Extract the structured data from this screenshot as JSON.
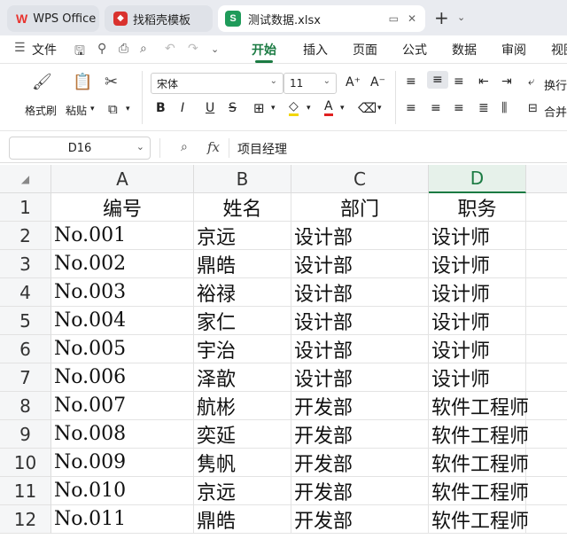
{
  "tabs": {
    "wps_label": "WPS Office",
    "template_label": "找稻壳模板",
    "doc_label": "测试数据.xlsx"
  },
  "menu": {
    "file": "文件",
    "items": [
      "开始",
      "插入",
      "页面",
      "公式",
      "数据",
      "审阅",
      "视图"
    ]
  },
  "ribbon": {
    "format_painter": "格式刷",
    "paste": "粘贴",
    "font_name": "宋体",
    "font_size": "11",
    "wrap": "换行",
    "merge": "合并"
  },
  "formula_bar": {
    "cell_ref": "D16",
    "fx": "fx",
    "content": "项目经理"
  },
  "sheet": {
    "columns": [
      "A",
      "B",
      "C",
      "D"
    ],
    "rows": [
      {
        "num": "1",
        "cells": [
          "编号",
          "姓名",
          "部门",
          "职务"
        ]
      },
      {
        "num": "2",
        "cells": [
          "No.001",
          "京远",
          "设计部",
          "设计师"
        ]
      },
      {
        "num": "3",
        "cells": [
          "No.002",
          "鼎皓",
          "设计部",
          "设计师"
        ]
      },
      {
        "num": "4",
        "cells": [
          "No.003",
          "裕禄",
          "设计部",
          "设计师"
        ]
      },
      {
        "num": "5",
        "cells": [
          "No.004",
          "家仁",
          "设计部",
          "设计师"
        ]
      },
      {
        "num": "6",
        "cells": [
          "No.005",
          "宇治",
          "设计部",
          "设计师"
        ]
      },
      {
        "num": "7",
        "cells": [
          "No.006",
          "泽歆",
          "设计部",
          "设计师"
        ]
      },
      {
        "num": "8",
        "cells": [
          "No.007",
          "航彬",
          "开发部",
          "软件工程师"
        ]
      },
      {
        "num": "9",
        "cells": [
          "No.008",
          "奕延",
          "开发部",
          "软件工程师"
        ]
      },
      {
        "num": "10",
        "cells": [
          "No.009",
          "隽帆",
          "开发部",
          "软件工程师"
        ]
      },
      {
        "num": "11",
        "cells": [
          "No.010",
          "京远",
          "开发部",
          "软件工程师"
        ]
      },
      {
        "num": "12",
        "cells": [
          "No.011",
          "鼎皓",
          "开发部",
          "软件工程师"
        ]
      }
    ]
  },
  "colors": {
    "accent": "#1b7b43",
    "wps_red": "#e8342f",
    "sheet_green": "#1f9b5a"
  }
}
